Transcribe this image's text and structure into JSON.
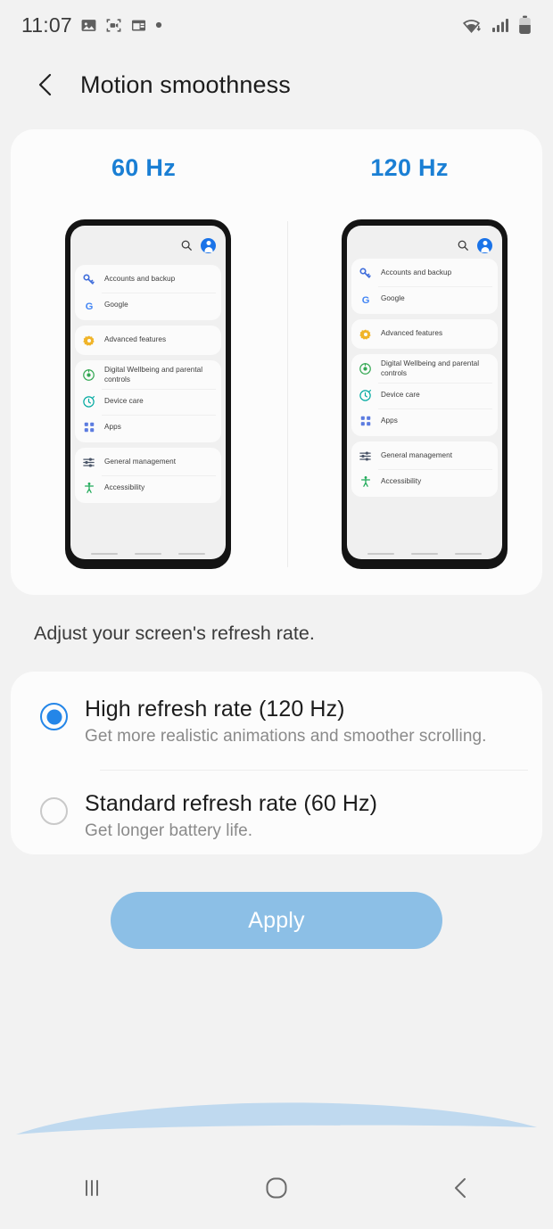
{
  "status_bar": {
    "time": "11:07",
    "left_icons": [
      "image-icon",
      "screen-record-icon",
      "calendar-icon",
      "dot-icon"
    ],
    "right_icons": [
      "wifi-icon",
      "signal-icon",
      "battery-icon"
    ]
  },
  "header": {
    "back_icon": "chevron-left-icon",
    "title": "Motion smoothness"
  },
  "preview": {
    "left_label": "60 Hz",
    "right_label": "120 Hz",
    "accent_color": "#1a7fd4",
    "phone_topbar_icons": [
      "search-icon",
      "account-avatar"
    ],
    "groups": [
      {
        "items": [
          {
            "icon": "key-icon",
            "label": "Accounts and backup",
            "color": "#3f6ddb"
          },
          {
            "icon": "google-g-icon",
            "label": "Google",
            "color": "#4285f4"
          }
        ]
      },
      {
        "items": [
          {
            "icon": "gear-icon",
            "label": "Advanced features",
            "color": "#f0b429"
          }
        ]
      },
      {
        "items": [
          {
            "icon": "digital-wellbeing-icon",
            "label": "Digital Wellbeing and parental controls",
            "color": "#34a853"
          },
          {
            "icon": "device-care-icon",
            "label": "Device care",
            "color": "#00a9a0"
          },
          {
            "icon": "apps-grid-icon",
            "label": "Apps",
            "color": "#5c7ce0"
          }
        ]
      },
      {
        "items": [
          {
            "icon": "sliders-icon",
            "label": "General management",
            "color": "#4a5568"
          },
          {
            "icon": "accessibility-icon",
            "label": "Accessibility",
            "color": "#1faa59"
          }
        ]
      }
    ]
  },
  "description": "Adjust your screen's refresh rate.",
  "options": [
    {
      "title": "High refresh rate (120 Hz)",
      "subtitle": "Get more realistic animations and smoother scrolling.",
      "selected": true
    },
    {
      "title": "Standard refresh rate (60 Hz)",
      "subtitle": "Get longer battery life.",
      "selected": false
    }
  ],
  "apply_button": {
    "label": "Apply",
    "color": "#8cbfe6"
  },
  "edge_arc": {
    "color": "#bfd9ef"
  },
  "nav_bar": {
    "recents_icon": "recents-icon",
    "home_icon": "home-icon",
    "back_icon": "back-icon"
  }
}
